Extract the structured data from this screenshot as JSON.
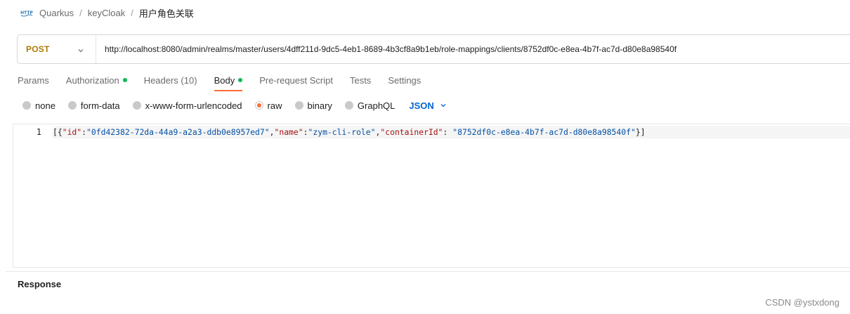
{
  "breadcrumb": {
    "items": [
      "Quarkus",
      "keyCloak"
    ],
    "current": "用户角色关联",
    "separator": "/",
    "icon": "http-icon"
  },
  "request": {
    "method": "POST",
    "url": "http://localhost:8080/admin/realms/master/users/4dff211d-9dc5-4eb1-8689-4b3cf8a9b1eb/role-mappings/clients/8752df0c-e8ea-4b7f-ac7d-d80e8a98540f"
  },
  "tabs": [
    {
      "label": "Params",
      "dot": false,
      "active": false
    },
    {
      "label": "Authorization",
      "dot": true,
      "active": false
    },
    {
      "label": "Headers (10)",
      "dot": false,
      "active": false
    },
    {
      "label": "Body",
      "dot": true,
      "active": true
    },
    {
      "label": "Pre-request Script",
      "dot": false,
      "active": false
    },
    {
      "label": "Tests",
      "dot": false,
      "active": false
    },
    {
      "label": "Settings",
      "dot": false,
      "active": false
    }
  ],
  "body_types": {
    "options": [
      "none",
      "form-data",
      "x-www-form-urlencoded",
      "raw",
      "binary",
      "GraphQL"
    ],
    "selected": "raw",
    "format": "JSON"
  },
  "editor": {
    "line_number": "1",
    "code": "[{\"id\":\"0fd42382-72da-44a9-a2a3-ddb0e8957ed7\",\"name\":\"zym-cli-role\",\"containerId\": \"8752df0c-e8ea-4b7f-ac7d-d80e8a98540f\"}]"
  },
  "response": {
    "label": "Response"
  },
  "watermark": "CSDN @ystxdong",
  "colors": {
    "method": "#ad7a03",
    "active_tab_underline": "#ff6c37",
    "dot": "#0cbb52",
    "json_select": "#0265d2",
    "json_key": "#a31515",
    "json_string": "#0451a5"
  }
}
